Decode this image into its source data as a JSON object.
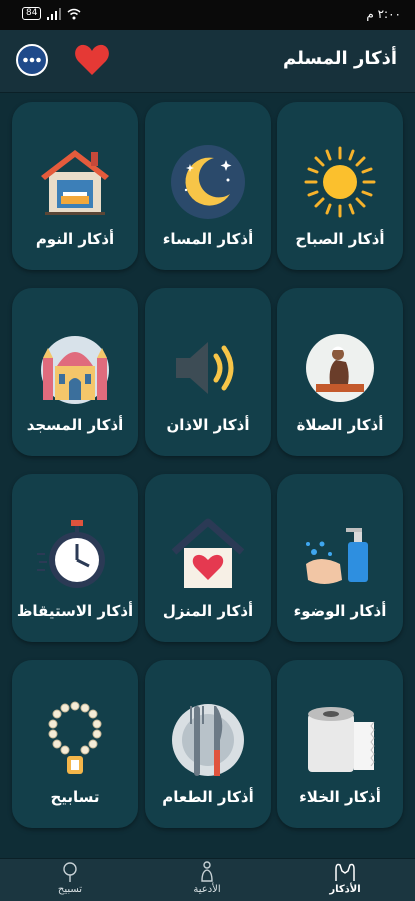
{
  "status_bar": {
    "time": "٢:٠٠ م",
    "battery": "84"
  },
  "app_bar": {
    "title": "أذكار المسلم"
  },
  "grid": {
    "items": [
      {
        "label": "أذكار الصباح",
        "icon": "sun-icon"
      },
      {
        "label": "أذكار المساء",
        "icon": "moon-icon"
      },
      {
        "label": "أذكار النوم",
        "icon": "house-bed-icon"
      },
      {
        "label": "أذكار الصلاة",
        "icon": "praying-man-icon"
      },
      {
        "label": "أذكار الاذان",
        "icon": "speaker-icon"
      },
      {
        "label": "أذكار المسجد",
        "icon": "mosque-icon"
      },
      {
        "label": "أذكار الوضوء",
        "icon": "hand-wash-icon"
      },
      {
        "label": "أذكار المنزل",
        "icon": "home-heart-icon"
      },
      {
        "label": "أذكار الاستيقاظ",
        "icon": "stopwatch-icon"
      },
      {
        "label": "أذكار الخلاء",
        "icon": "toilet-paper-icon"
      },
      {
        "label": "أذكار الطعام",
        "icon": "plate-fork-knife-icon"
      },
      {
        "label": "تسابيح",
        "icon": "prayer-beads-icon"
      }
    ]
  },
  "bottom_nav": {
    "azkar": "الأذكار",
    "duaa": "الأدعية",
    "tasbeeh": "تسبيح"
  },
  "colors": {
    "background": "#0f2d36",
    "card": "#133f4a",
    "accent_heart": "#e53935"
  }
}
